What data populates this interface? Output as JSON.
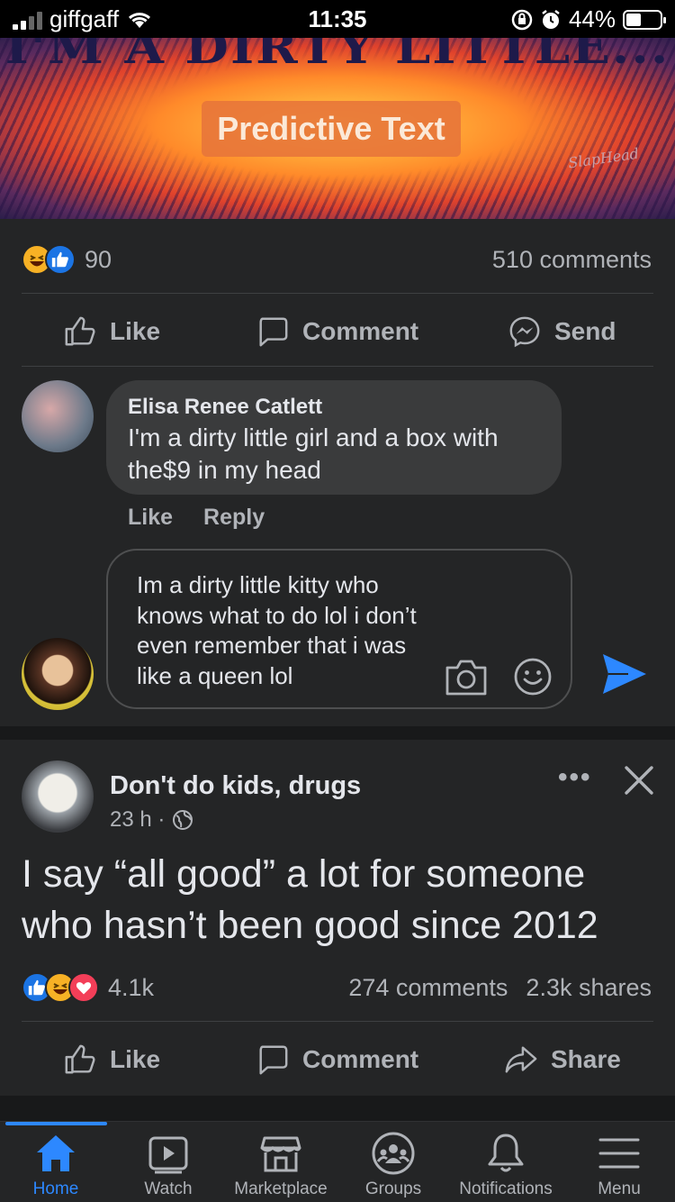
{
  "status_bar": {
    "carrier": "giffgaff",
    "time": "11:35",
    "battery": "44%",
    "battery_level": 0.44
  },
  "post1": {
    "image": {
      "headline": "I'M A DIRTY LITTLE...",
      "label": "Predictive Text",
      "signature": "SlapHead"
    },
    "reaction_count": "90",
    "comments_count": "510 comments",
    "actions": {
      "like": "Like",
      "comment": "Comment",
      "send": "Send"
    },
    "comment": {
      "author": "Elisa Renee Catlett",
      "text": "I'm a dirty little girl and a box with the$9 in my head",
      "like": "Like",
      "reply": "Reply"
    },
    "composer": {
      "typed_text": "Im a dirty little kitty who knows what to do lol i don’t even remember that i was like a queen lol"
    }
  },
  "post2": {
    "author": "Don't do kids, drugs",
    "time": "23 h ·",
    "text": "I say “all good” a lot for someone who hasn’t been good since 2012",
    "reaction_count": "4.1k",
    "comments_count": "274 comments",
    "shares_count": "2.3k shares",
    "actions": {
      "like": "Like",
      "comment": "Comment",
      "share": "Share"
    }
  },
  "tabbar": {
    "items": [
      {
        "label": "Home",
        "icon": "home-icon",
        "active": true
      },
      {
        "label": "Watch",
        "icon": "watch-icon"
      },
      {
        "label": "Marketplace",
        "icon": "marketplace-icon"
      },
      {
        "label": "Groups",
        "icon": "groups-icon"
      },
      {
        "label": "Notifications",
        "icon": "bell-icon"
      },
      {
        "label": "Menu",
        "icon": "menu-icon"
      }
    ]
  },
  "colors": {
    "background": "#18191a",
    "card": "#242526",
    "bubble": "#3a3b3c",
    "accent": "#2d88ff",
    "secondary_text": "#b0b3b8"
  }
}
